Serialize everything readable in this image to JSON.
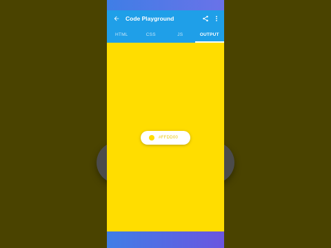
{
  "app_bar": {
    "title": "Code Playground",
    "back_icon": "arrow-left-icon",
    "share_icon": "share-icon",
    "more_icon": "more-vertical-icon"
  },
  "tabs": [
    {
      "label": "HTML",
      "active": false
    },
    {
      "label": "CSS",
      "active": false
    },
    {
      "label": "JS",
      "active": false
    },
    {
      "label": "OUTPUT",
      "active": true
    }
  ],
  "output": {
    "background_color": "#ffdd00",
    "chip_text": "#FFDD00",
    "chip_dot_color": "#ffdd00"
  },
  "colors": {
    "app_bar": "#1f9fe8",
    "page_background": "#4a4300"
  }
}
